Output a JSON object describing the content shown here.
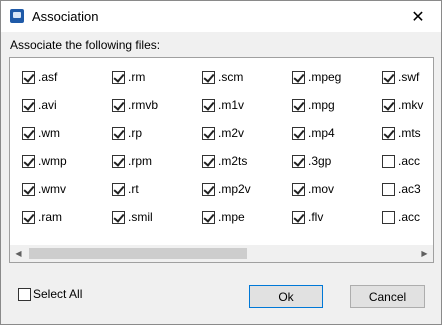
{
  "window": {
    "title": "Association"
  },
  "label": "Associate the following files:",
  "columns": [
    [
      {
        "ext": ".asf",
        "checked": true
      },
      {
        "ext": ".avi",
        "checked": true
      },
      {
        "ext": ".wm",
        "checked": true
      },
      {
        "ext": ".wmp",
        "checked": true
      },
      {
        "ext": ".wmv",
        "checked": true
      },
      {
        "ext": ".ram",
        "checked": true
      }
    ],
    [
      {
        "ext": ".rm",
        "checked": true
      },
      {
        "ext": ".rmvb",
        "checked": true
      },
      {
        "ext": ".rp",
        "checked": true
      },
      {
        "ext": ".rpm",
        "checked": true
      },
      {
        "ext": ".rt",
        "checked": true
      },
      {
        "ext": ".smil",
        "checked": true
      }
    ],
    [
      {
        "ext": ".scm",
        "checked": true
      },
      {
        "ext": ".m1v",
        "checked": true
      },
      {
        "ext": ".m2v",
        "checked": true
      },
      {
        "ext": ".m2ts",
        "checked": true
      },
      {
        "ext": ".mp2v",
        "checked": true
      },
      {
        "ext": ".mpe",
        "checked": true
      }
    ],
    [
      {
        "ext": ".mpeg",
        "checked": true
      },
      {
        "ext": ".mpg",
        "checked": true
      },
      {
        "ext": ".mp4",
        "checked": true
      },
      {
        "ext": ".3gp",
        "checked": true
      },
      {
        "ext": ".mov",
        "checked": true
      },
      {
        "ext": ".flv",
        "checked": true
      }
    ],
    [
      {
        "ext": ".swf",
        "checked": true
      },
      {
        "ext": ".mkv",
        "checked": true
      },
      {
        "ext": ".mts",
        "checked": true
      },
      {
        "ext": ".acc",
        "checked": false
      },
      {
        "ext": ".ac3",
        "checked": false
      },
      {
        "ext": ".acc",
        "checked": false
      }
    ]
  ],
  "select_all": {
    "label": "Select All",
    "checked": false
  },
  "buttons": {
    "ok": "Ok",
    "cancel": "Cancel"
  }
}
